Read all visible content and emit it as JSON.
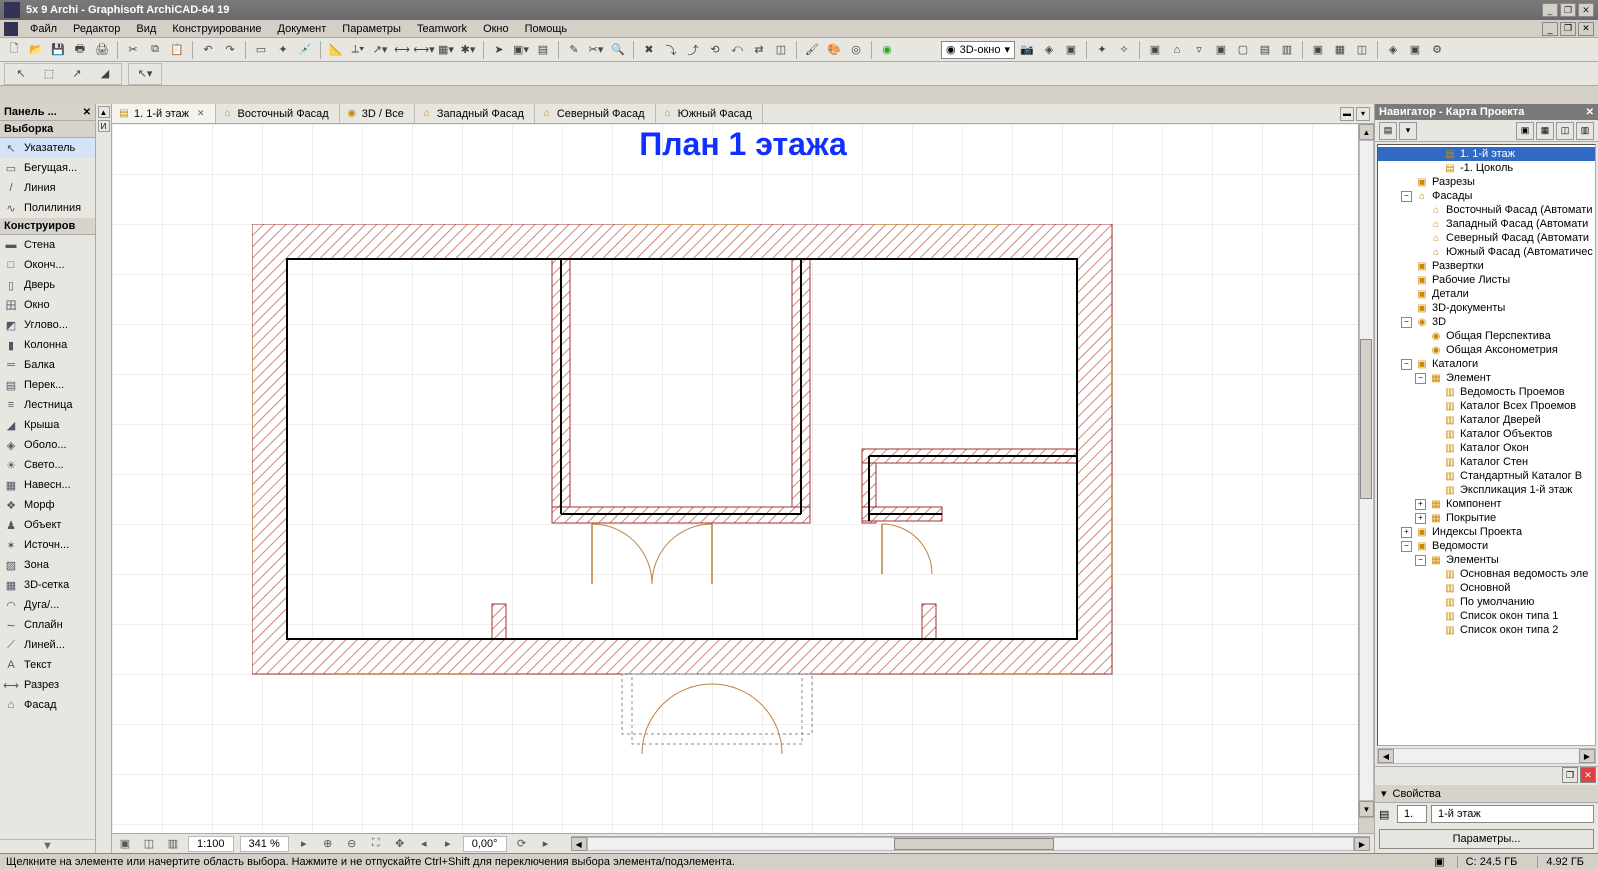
{
  "title": "5x 9 Archi - Graphisoft ArchiCAD-64 19",
  "menus": [
    "Файл",
    "Редактор",
    "Вид",
    "Конструирование",
    "Документ",
    "Параметры",
    "Teamwork",
    "Окно",
    "Помощь"
  ],
  "toolbar3dWindow": "3D-окно",
  "toolbox": {
    "panelTitle": "Панель ...",
    "sectionSelect": "Выборка",
    "sectionConstruct": "Конструиров",
    "select": [
      {
        "icon": "↖",
        "label": "Указатель"
      },
      {
        "icon": "▭",
        "label": "Бегущая..."
      },
      {
        "icon": "/",
        "label": "Линия"
      },
      {
        "icon": "∿",
        "label": "Полилиния"
      }
    ],
    "construct": [
      {
        "icon": "▬",
        "label": "Стена"
      },
      {
        "icon": "□",
        "label": "Оконч..."
      },
      {
        "icon": "▯",
        "label": "Дверь"
      },
      {
        "icon": "田",
        "label": "Окно"
      },
      {
        "icon": "◩",
        "label": "Углово..."
      },
      {
        "icon": "▮",
        "label": "Колонна"
      },
      {
        "icon": "═",
        "label": "Балка"
      },
      {
        "icon": "▤",
        "label": "Перек..."
      },
      {
        "icon": "≡",
        "label": "Лестница"
      },
      {
        "icon": "◢",
        "label": "Крыша"
      },
      {
        "icon": "◈",
        "label": "Оболо..."
      },
      {
        "icon": "☀",
        "label": "Свето..."
      },
      {
        "icon": "▦",
        "label": "Навесн..."
      },
      {
        "icon": "❖",
        "label": "Морф"
      },
      {
        "icon": "♟",
        "label": "Объект"
      },
      {
        "icon": "✶",
        "label": "Источн..."
      },
      {
        "icon": "▨",
        "label": "Зона"
      },
      {
        "icon": "▦",
        "label": "3D-сетка"
      },
      {
        "icon": "◠",
        "label": "Дуга/..."
      },
      {
        "icon": "∼",
        "label": "Сплайн"
      },
      {
        "icon": "⟋",
        "label": "Линей..."
      },
      {
        "icon": "A",
        "label": "Текст"
      },
      {
        "icon": "⟷",
        "label": "Разрез"
      },
      {
        "icon": "⌂",
        "label": "Фасад"
      }
    ]
  },
  "tabs": [
    {
      "icon": "▤",
      "label": "1. 1-й этаж",
      "active": true,
      "closable": true
    },
    {
      "icon": "⌂",
      "label": "Восточный Фасад"
    },
    {
      "icon": "◉",
      "label": "3D / Все"
    },
    {
      "icon": "⌂",
      "label": "Западный Фасад"
    },
    {
      "icon": "⌂",
      "label": "Северный Фасад"
    },
    {
      "icon": "⌂",
      "label": "Южный Фасад"
    }
  ],
  "canvasTitle": "План 1 этажа",
  "bottomBar": {
    "scale": "1:100",
    "zoom": "341 %",
    "angle": "0,00°"
  },
  "navigator": {
    "title": "Навигатор - Карта Проекта",
    "tree": [
      {
        "d": 3,
        "exp": "",
        "icon": "▤",
        "label": "1. 1-й этаж",
        "sel": true
      },
      {
        "d": 3,
        "exp": "",
        "icon": "▤",
        "label": "-1. Цоколь"
      },
      {
        "d": 1,
        "exp": "",
        "icon": "▣",
        "label": "Разрезы"
      },
      {
        "d": 1,
        "exp": "−",
        "icon": "⌂",
        "label": "Фасады"
      },
      {
        "d": 2,
        "exp": "",
        "icon": "⌂",
        "label": "Восточный Фасад (Автомати"
      },
      {
        "d": 2,
        "exp": "",
        "icon": "⌂",
        "label": "Западный Фасад (Автомати"
      },
      {
        "d": 2,
        "exp": "",
        "icon": "⌂",
        "label": "Северный Фасад (Автомати"
      },
      {
        "d": 2,
        "exp": "",
        "icon": "⌂",
        "label": "Южный Фасад (Автоматичес"
      },
      {
        "d": 1,
        "exp": "",
        "icon": "▣",
        "label": "Развертки"
      },
      {
        "d": 1,
        "exp": "",
        "icon": "▣",
        "label": "Рабочие Листы"
      },
      {
        "d": 1,
        "exp": "",
        "icon": "▣",
        "label": "Детали"
      },
      {
        "d": 1,
        "exp": "",
        "icon": "▣",
        "label": "3D-документы"
      },
      {
        "d": 1,
        "exp": "−",
        "icon": "◉",
        "label": "3D"
      },
      {
        "d": 2,
        "exp": "",
        "icon": "◉",
        "label": "Общая Перспектива"
      },
      {
        "d": 2,
        "exp": "",
        "icon": "◉",
        "label": "Общая Аксонометрия"
      },
      {
        "d": 1,
        "exp": "−",
        "icon": "▣",
        "label": "Каталоги"
      },
      {
        "d": 2,
        "exp": "−",
        "icon": "▦",
        "label": "Элемент"
      },
      {
        "d": 3,
        "exp": "",
        "icon": "▥",
        "label": "Ведомость Проемов"
      },
      {
        "d": 3,
        "exp": "",
        "icon": "▥",
        "label": "Каталог Всех Проемов"
      },
      {
        "d": 3,
        "exp": "",
        "icon": "▥",
        "label": "Каталог Дверей"
      },
      {
        "d": 3,
        "exp": "",
        "icon": "▥",
        "label": "Каталог Объектов"
      },
      {
        "d": 3,
        "exp": "",
        "icon": "▥",
        "label": "Каталог Окон"
      },
      {
        "d": 3,
        "exp": "",
        "icon": "▥",
        "label": "Каталог Стен"
      },
      {
        "d": 3,
        "exp": "",
        "icon": "▥",
        "label": "Стандартный Каталог В"
      },
      {
        "d": 3,
        "exp": "",
        "icon": "▥",
        "label": "Экспликация 1-й этаж"
      },
      {
        "d": 2,
        "exp": "+",
        "icon": "▦",
        "label": "Компонент"
      },
      {
        "d": 2,
        "exp": "+",
        "icon": "▦",
        "label": "Покрытие"
      },
      {
        "d": 1,
        "exp": "+",
        "icon": "▣",
        "label": "Индексы Проекта"
      },
      {
        "d": 1,
        "exp": "−",
        "icon": "▣",
        "label": "Ведомости"
      },
      {
        "d": 2,
        "exp": "−",
        "icon": "▦",
        "label": "Элементы"
      },
      {
        "d": 3,
        "exp": "",
        "icon": "▥",
        "label": "Основная ведомость эле"
      },
      {
        "d": 3,
        "exp": "",
        "icon": "▥",
        "label": "Основной"
      },
      {
        "d": 3,
        "exp": "",
        "icon": "▥",
        "label": "По умолчанию"
      },
      {
        "d": 3,
        "exp": "",
        "icon": "▥",
        "label": "Список окон типа 1"
      },
      {
        "d": 3,
        "exp": "",
        "icon": "▥",
        "label": "Список окон типа 2"
      }
    ]
  },
  "properties": {
    "header": "Свойства",
    "id": "1.",
    "name": "1-й этаж",
    "button": "Параметры..."
  },
  "status": {
    "hint": "Щелкните на элементе или начертите область выбора. Нажмите и не отпускайте Ctrl+Shift для переключения выбора элемента/подэлемента.",
    "c": "C: 24.5 ГБ",
    "mem": "4.92 ГБ"
  }
}
